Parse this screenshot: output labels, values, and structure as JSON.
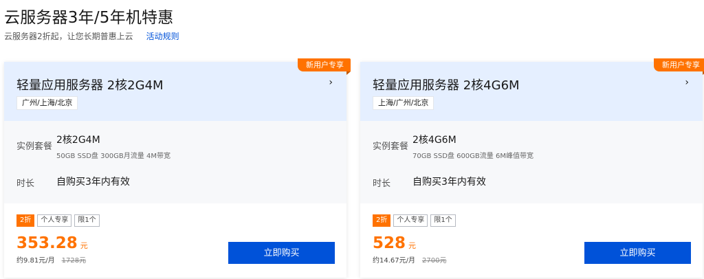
{
  "header": {
    "title": "云服务器3年/5年机特惠",
    "subtitle": "云服务器2折起，让您长期普惠上云",
    "rules_link": "活动规则"
  },
  "cards": [
    {
      "badge": "新用户专享",
      "title": "轻量应用服务器 2核2G4M",
      "chevron": "›",
      "regions": "广州/上海/北京",
      "spec_label": "实例套餐",
      "spec_main": "2核2G4M",
      "spec_sub": "50GB SSD盘 300GB月流量 4M带宽",
      "duration_label": "时长",
      "duration_value": "自购买3年内有效",
      "tags": [
        "2折",
        "个人专享",
        "限1个"
      ],
      "price": "353.28",
      "price_unit": "元",
      "monthly": "约9.81元/月",
      "original_price": "1728元",
      "buy_label": "立即购买"
    },
    {
      "badge": "新用户专享",
      "title": "轻量应用服务器 2核4G6M",
      "chevron": "›",
      "regions": "上海/广州/北京",
      "spec_label": "实例套餐",
      "spec_main": "2核4G6M",
      "spec_sub": "70GB SSD盘 600GB流量 6M峰值带宽",
      "duration_label": "时长",
      "duration_value": "自购买3年内有效",
      "tags": [
        "2折",
        "个人专享",
        "限1个"
      ],
      "price": "528",
      "price_unit": "元",
      "monthly": "约14.67元/月",
      "original_price": "2700元",
      "buy_label": "立即购买"
    }
  ],
  "colors": {
    "accent": "#ff7200",
    "primary_button": "#0052d9",
    "card_header_bg": "#e5efff",
    "card_body_bg": "#f7f8fa"
  }
}
